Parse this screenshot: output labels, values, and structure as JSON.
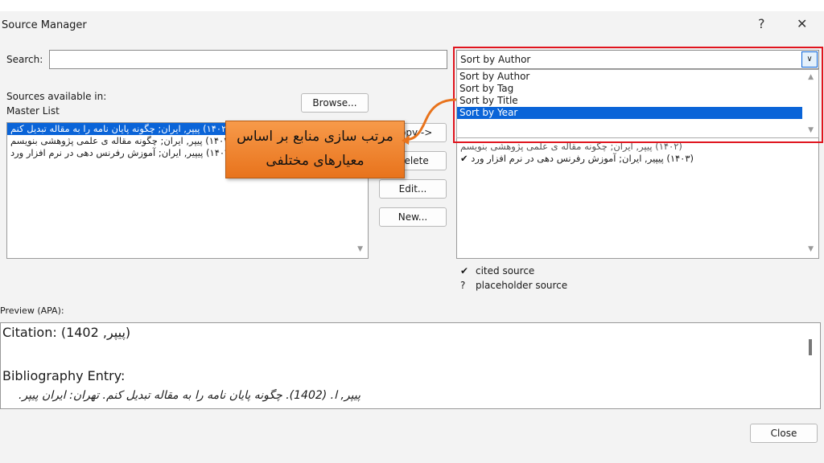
{
  "window": {
    "title": "Source Manager",
    "help": "?",
    "close": "✕"
  },
  "search": {
    "label": "Search:",
    "value": "",
    "placeholder": ""
  },
  "sort": {
    "selected": "Sort by Author",
    "options": [
      "Sort by Author",
      "Sort by Tag",
      "Sort by Title",
      "Sort by Year"
    ],
    "highlighted": 3
  },
  "left": {
    "label1": "Sources available in:",
    "label2": "Master List",
    "browse": "Browse...",
    "items": [
      "(۱۴۰۲) پیپر, ایران; چگونه پایان نامه را به مقاله تبدیل کنم",
      "(۱۴۰۲) پیپر, ایران; چگونه مقاله ی علمی پژوهشی بنویسم",
      "(۱۴۰۳) پیپیر, ایران; آموزش رفرنس دهی در نرم افزار ورد"
    ]
  },
  "buttons": {
    "copy": "Copy ->",
    "delete": "Delete",
    "edit": "Edit...",
    "new": "New..."
  },
  "right": {
    "items": [
      "(۱۴۰۲) پیپر, ایران; چگونه مقاله ی علمی پژوهشی بنویسم",
      "(۱۴۰۳) پیپیر, ایران; آموزش رفرنس دهی در نرم افزار ورد ✔"
    ]
  },
  "legend": [
    {
      "symbol": "✔",
      "text": "cited source"
    },
    {
      "symbol": "?",
      "text": "placeholder source"
    }
  ],
  "preview": {
    "label": "Preview (APA):",
    "citation": "Citation:  (1402 ,پیپر)",
    "bib_label": "Bibliography Entry:",
    "bib": "پیپر, ا. (1402). چگونه پایان نامه را به مقاله تبدیل کنم. تهران: ایران پیپر."
  },
  "callout": {
    "text": "مرتب سازی منابع بر اساس معیارهای مختلفی"
  },
  "close_button": "Close",
  "colors": {
    "highlight": "#0a64d8",
    "annotation_border": "#e0141e",
    "callout": "#f08a34"
  }
}
